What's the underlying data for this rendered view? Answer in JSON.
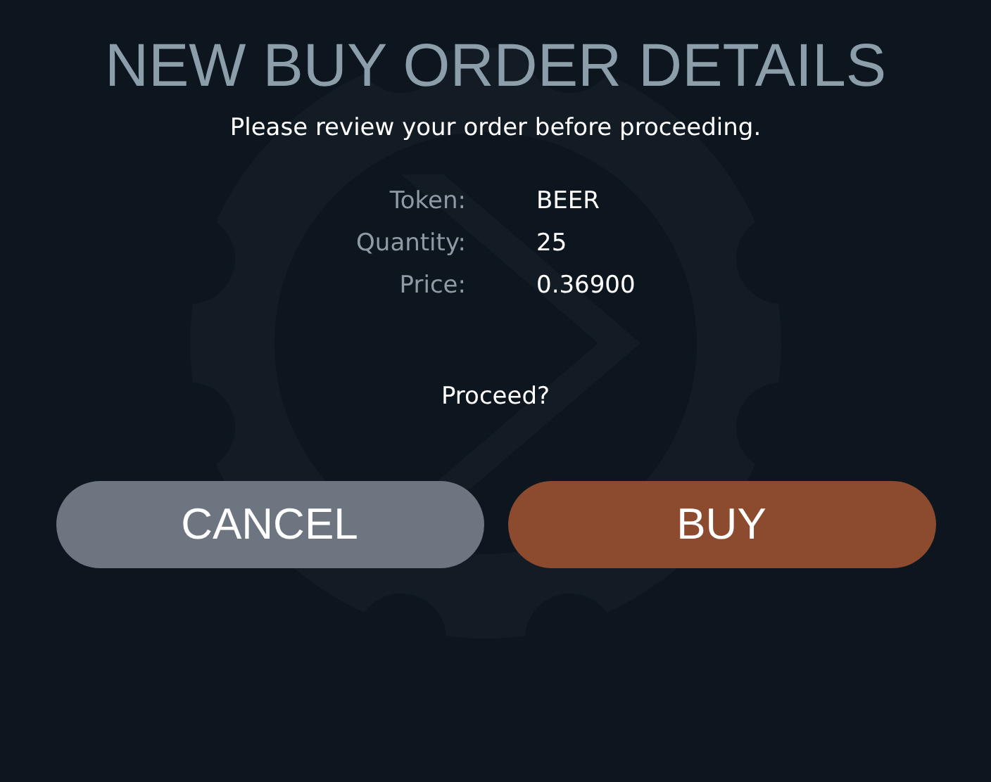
{
  "title": "NEW BUY ORDER DETAILS",
  "subtitle": "Please review your order before proceeding.",
  "details": [
    {
      "label": "Token:",
      "value": "BEER"
    },
    {
      "label": "Quantity:",
      "value": "25"
    },
    {
      "label": "Price:",
      "value": "0.36900"
    }
  ],
  "prompt": "Proceed?",
  "buttons": [
    {
      "label": "CANCEL",
      "kind": "cancel"
    },
    {
      "label": "BUY",
      "kind": "confirm"
    }
  ]
}
